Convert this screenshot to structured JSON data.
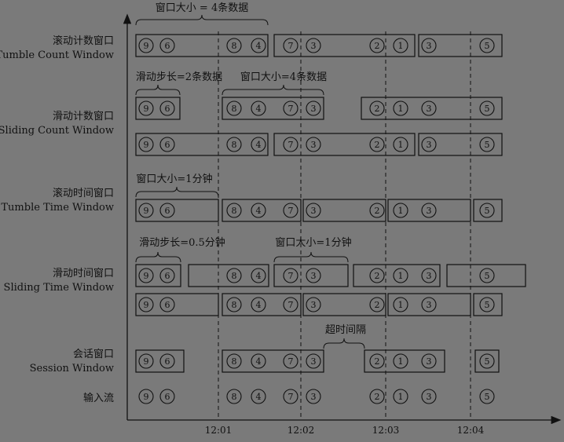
{
  "time_ticks": [
    "12:01",
    "12:02",
    "12:03",
    "12:04"
  ],
  "rows": [
    {
      "id": "tumble-count",
      "cn": "滚动计数窗口",
      "en": "Tumble Count Window"
    },
    {
      "id": "sliding-count",
      "cn": "滑动计数窗口",
      "en": "Sliding Count Window"
    },
    {
      "id": "tumble-time",
      "cn": "滚动时间窗口",
      "en": "Tumble Time Window"
    },
    {
      "id": "sliding-time",
      "cn": "滑动时间窗口",
      "en": "Sliding Time Window"
    },
    {
      "id": "session",
      "cn": "会话窗口",
      "en": "Session Window"
    },
    {
      "id": "input",
      "cn": "输入流",
      "en": ""
    }
  ],
  "annotations": [
    {
      "id": "window-size-4",
      "text": "窗口大小 = 4条数据"
    },
    {
      "id": "slide-step-2",
      "text": "滑动步长=2条数据"
    },
    {
      "id": "window-size-4b",
      "text": "窗口大小=4条数据"
    },
    {
      "id": "window-size-1min",
      "text": "窗口大小=1分钟"
    },
    {
      "id": "slide-step-05min",
      "text": "滑动步长=0.5分钟"
    },
    {
      "id": "window-size-1min-b",
      "text": "窗口大小=1分钟"
    },
    {
      "id": "session-gap",
      "text": "超时间隔"
    }
  ],
  "input_stream": [
    "9",
    "6",
    "8",
    "4",
    "7",
    "3",
    "2",
    "1",
    "3",
    "5"
  ],
  "colors": {
    "background": "#7a7a7a",
    "ink": "#111111"
  }
}
